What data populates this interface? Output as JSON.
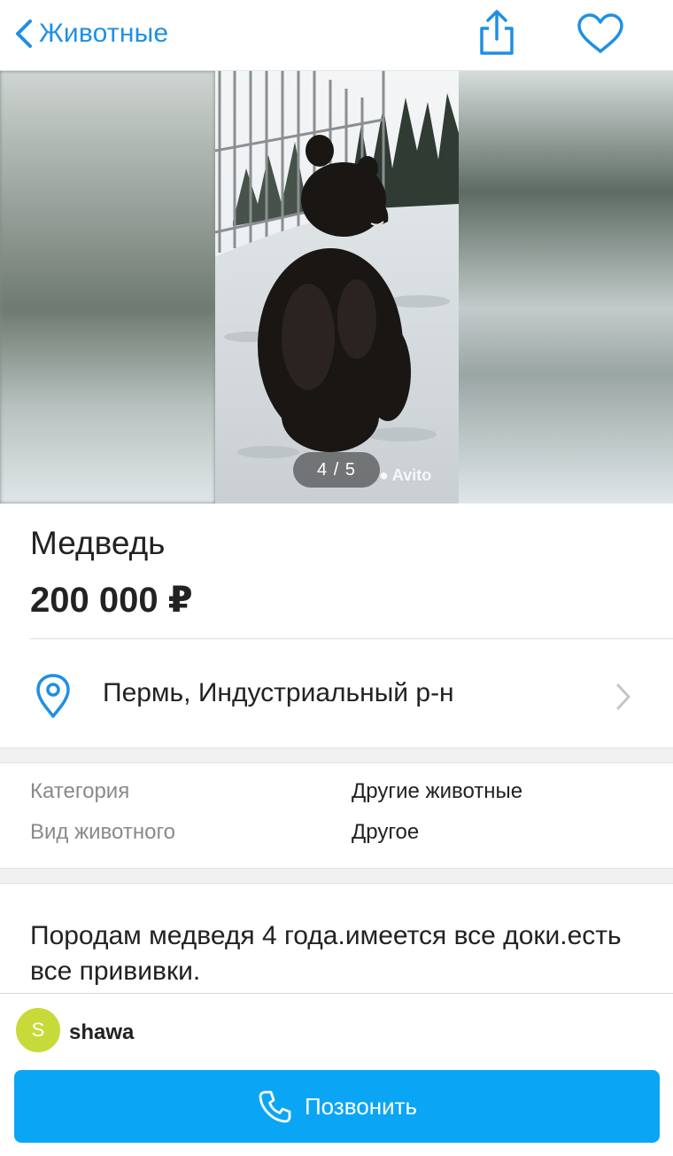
{
  "header": {
    "back_label": "Животные",
    "icons": [
      "chevron-left-icon",
      "share-icon",
      "heart-icon"
    ],
    "accent_color": "#1f8fe6"
  },
  "gallery": {
    "counter": "4 / 5",
    "watermark": "Avito"
  },
  "listing": {
    "title": "Медведь",
    "price": "200 000 ₽"
  },
  "location": {
    "text": "Пермь, Индустриальный р-н",
    "icons": [
      "location-pin-icon",
      "chevron-right-icon"
    ]
  },
  "params": [
    {
      "key": "Категория",
      "value": "Другие животные"
    },
    {
      "key": "Вид животного",
      "value": "Другое"
    }
  ],
  "description": "Породам медведя 4 года.имеется все доки.есть все прививки.",
  "seller": {
    "initial": "S",
    "name": "shawa",
    "avatar_color": "#c7da3a"
  },
  "call_button": {
    "label": "Позвонить",
    "color": "#0aa6f5",
    "icon": "phone-icon"
  }
}
